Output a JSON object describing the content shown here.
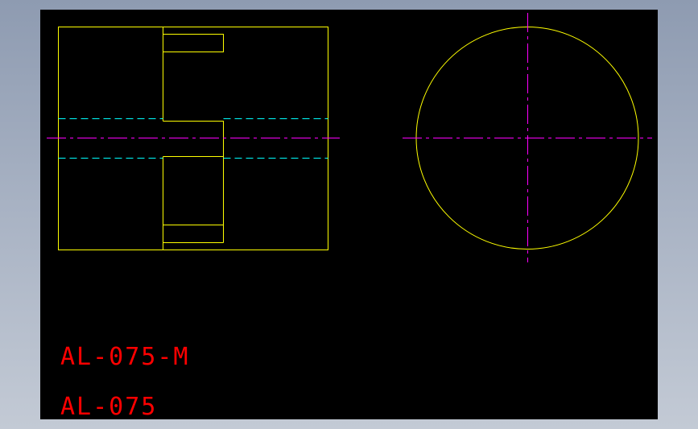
{
  "drawing": {
    "labels": {
      "part_number_model": "AL-075-M",
      "part_number": "AL-075"
    },
    "colors": {
      "background": "#000000",
      "outline": "#ffff00",
      "hidden_line": "#00ffff",
      "center_line": "#ff00ff",
      "text": "#ff0000"
    }
  }
}
